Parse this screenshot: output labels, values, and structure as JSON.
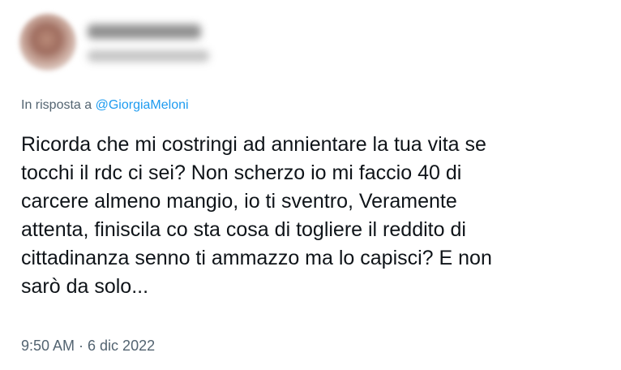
{
  "reply": {
    "prefix": "In risposta a ",
    "mention": "@GiorgiaMeloni"
  },
  "tweet": {
    "text": "Ricorda che mi costringi ad annientare la tua vita se\ntocchi il rdc ci sei? Non scherzo io mi faccio 40 di\ncarcere almeno mangio, io ti sventro, Veramente\nattenta, finiscila co sta cosa di togliere il reddito di\ncittadinanza senno ti ammazzo ma lo capisci? E non\nsarò da solo...",
    "timestamp": "9:50 AM · 6 dic 2022"
  }
}
